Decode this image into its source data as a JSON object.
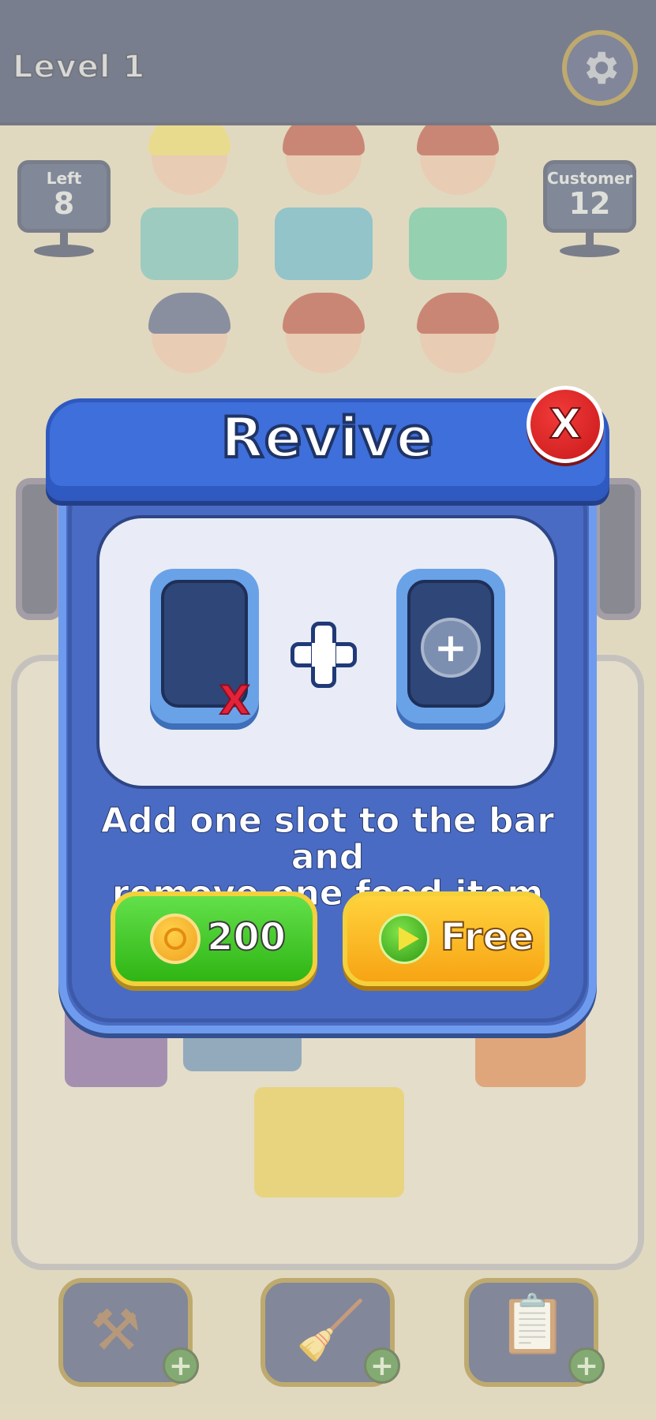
{
  "header": {
    "level_label": "Level 1",
    "settings_icon": "gear-icon"
  },
  "signs": {
    "left": {
      "label": "Left",
      "value": "8"
    },
    "customer": {
      "label": "Customer",
      "value": "12"
    }
  },
  "tools": [
    {
      "icon": "spatula-icon",
      "badge": "+"
    },
    {
      "icon": "broom-icon",
      "badge": "+"
    },
    {
      "icon": "clipboard-icon",
      "badge": "+"
    }
  ],
  "dialog": {
    "title": "Revive",
    "close_label": "X",
    "slot_removed_mark": "X",
    "slot_add_mark": "+",
    "description_line1": "Add one slot to the bar and",
    "description_line2": "remove one food item",
    "coin_button_label": "200",
    "free_button_label": "Free"
  },
  "colors": {
    "dialog_blue": "#4a6bc3",
    "header_blue": "#3e6fdb",
    "coin_button_green": "#2fb514",
    "free_button_orange": "#f7a414",
    "close_red": "#e3233a"
  }
}
